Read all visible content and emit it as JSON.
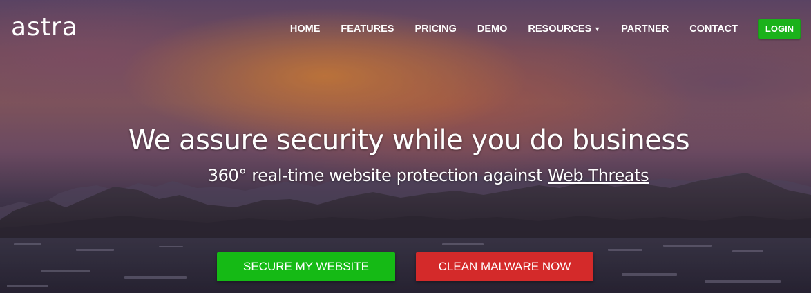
{
  "brand": {
    "logo_text": "astra"
  },
  "nav": {
    "items": [
      {
        "label": "HOME"
      },
      {
        "label": "FEATURES"
      },
      {
        "label": "PRICING"
      },
      {
        "label": "DEMO"
      },
      {
        "label": "RESOURCES",
        "has_dropdown": true
      },
      {
        "label": "PARTNER"
      },
      {
        "label": "CONTACT"
      }
    ],
    "login_label": "LOGIN",
    "dropdown_caret": "▼"
  },
  "hero": {
    "headline": "We assure security while you do business",
    "subline_prefix": "360° real-time website protection against",
    "subline_link": "Web Threats"
  },
  "actions": {
    "secure_label": "SECURE MY WEBSITE",
    "clean_label": "CLEAN MALWARE NOW"
  },
  "colors": {
    "login_green": "#1bb21b",
    "secure_green": "#15ba15",
    "clean_red": "#d42a2a"
  }
}
